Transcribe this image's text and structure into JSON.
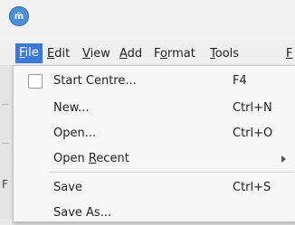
{
  "app": {
    "logo_text": "m̃"
  },
  "menubar": {
    "items": [
      {
        "label": "File",
        "mnemonic": "F",
        "rest": "ile"
      },
      {
        "label": "Edit",
        "mnemonic": "E",
        "rest": "dit"
      },
      {
        "label": "View",
        "mnemonic": "V",
        "rest": "iew"
      },
      {
        "label": "Add",
        "mnemonic": "A",
        "rest": "dd"
      },
      {
        "label": "Format",
        "pre": "F",
        "mnemonic": "o",
        "rest": "rmat"
      },
      {
        "label": "Tools",
        "mnemonic": "T",
        "rest": "ools"
      },
      {
        "label": "F",
        "mnemonic": "F",
        "rest": ""
      }
    ]
  },
  "file_menu": {
    "items": [
      {
        "label": "Start Centre...",
        "shortcut": "F4",
        "has_checkbox": true
      },
      {
        "label": "New...",
        "shortcut": "Ctrl+N"
      },
      {
        "label": "Open...",
        "shortcut": "Ctrl+O"
      },
      {
        "label_pre": "Open ",
        "label_mnemonic": "R",
        "label_rest": "ecent",
        "shortcut": "",
        "submenu": true
      },
      {
        "label": "Save",
        "shortcut": "Ctrl+S"
      },
      {
        "label": "Save As...",
        "shortcut": ""
      }
    ]
  },
  "background": {
    "side_mark": "F"
  },
  "colors": {
    "menu_highlight": "#3b78d8",
    "logo": "#4b8fd6"
  }
}
